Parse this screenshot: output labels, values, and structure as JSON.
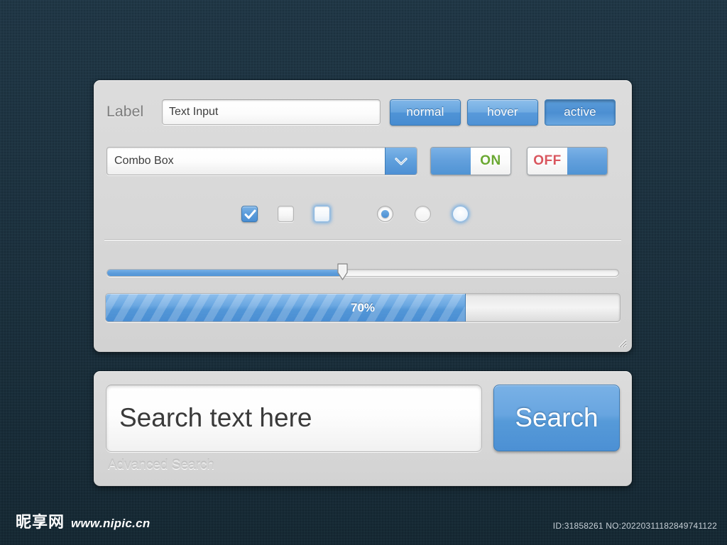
{
  "background": {
    "color": "#1d3340"
  },
  "widgets_panel": {
    "row1": {
      "label": "Label",
      "text_input_value": "Text Input",
      "text_input_placeholder": "Text Input",
      "buttons": [
        {
          "label": "normal",
          "state": "normal"
        },
        {
          "label": "hover",
          "state": "hover"
        },
        {
          "label": "active",
          "state": "active"
        }
      ]
    },
    "row2": {
      "combo_value": "Combo Box",
      "combo_icon": "chevron-down-icon",
      "toggles": [
        {
          "label": "ON",
          "state": "on",
          "color": "#6aa832"
        },
        {
          "label": "OFF",
          "state": "off",
          "color": "#d9565e"
        }
      ]
    },
    "row3": {
      "checkboxes": [
        {
          "state": "checked",
          "icon": "checkmark-icon"
        },
        {
          "state": "unchecked"
        },
        {
          "state": "focused"
        }
      ],
      "radios": [
        {
          "state": "selected"
        },
        {
          "state": "unselected"
        },
        {
          "state": "focused"
        }
      ]
    },
    "slider": {
      "value": 46,
      "min": 0,
      "max": 100
    },
    "progress": {
      "value": 70,
      "label": "70%",
      "fill_color": "#5c9cdb"
    },
    "resize_grip": "resize-grip-icon"
  },
  "search_panel": {
    "input_value": "Search text here",
    "input_placeholder": "Search text here",
    "search_button": "Search",
    "advanced_link": "Advanced Search",
    "button_color": "#5a9bd8"
  },
  "footer": {
    "watermark_cn": "昵享网",
    "watermark_url": "www.nipic.cn",
    "id_text": "ID:31858261 NO:20220311182849741122"
  }
}
